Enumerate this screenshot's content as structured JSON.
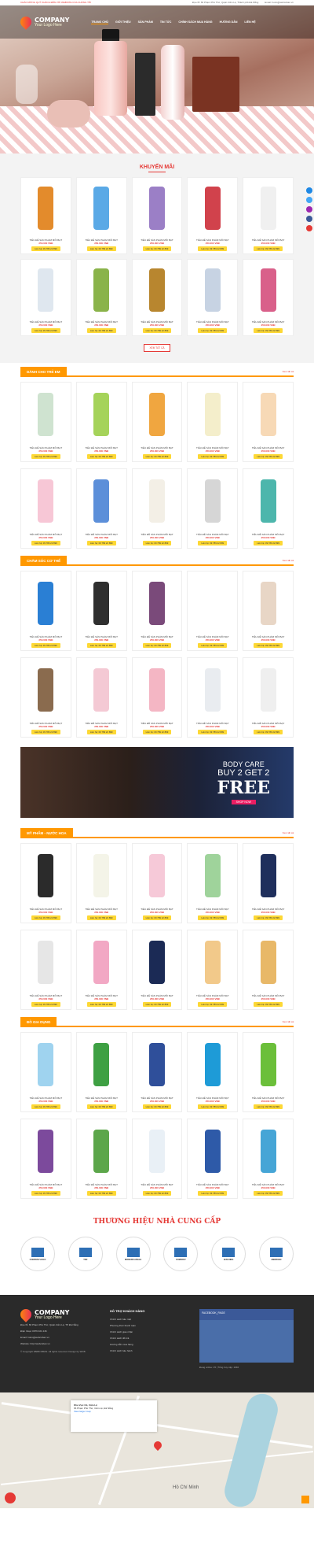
{
  "topbar": {
    "notice": "CHÀO MỪNG QUÝ KHÁCH ĐẾN VỚI WEBSITE CỦA CHÚNG TÔI",
    "address": "Địa chỉ: 66 Phạm Phú Thứ, Quận Cẩm Lệ, Thành phố Đà Nẵng",
    "email": "Email: hotro@webcoban.vn"
  },
  "logo": {
    "name": "COMPANY",
    "tagline": "Your Logo Here"
  },
  "nav": [
    "TRANG CHỦ",
    "GIỚI THIỆU",
    "SẢN PHẨM",
    "TIN TỨC",
    "CHÍNH SÁCH MUA HÀNG",
    "HƯỚNG DẪN",
    "LIÊN HỆ"
  ],
  "promo": {
    "title": "KHUYẾN MÃI",
    "view_more": "XEM TẤT CẢ",
    "products": [
      {
        "name": "TIÊU ĐỀ SẢN PHẨM MỖI BẠT",
        "price": "250.000 VNĐ",
        "cta": "Liên hệ: 09 789 22 899",
        "color": "#e38b2c"
      },
      {
        "name": "TIÊU ĐỀ SẢN PHẨM MỖI BẠT",
        "price": "250.000 VNĐ",
        "cta": "Liên hệ: 09 789 22 899",
        "color": "#5aa9e6"
      },
      {
        "name": "TIÊU ĐỀ SẢN PHẨM MỖI BẠT",
        "price": "250.000 VNĐ",
        "cta": "Liên hệ: 09 789 22 899",
        "color": "#9b7fc6"
      },
      {
        "name": "TIÊU ĐỀ SẢN PHẨM MỖI BẠT",
        "price": "250.000 VNĐ",
        "cta": "Liên hệ: 09 789 22 899",
        "color": "#d1424c"
      },
      {
        "name": "TIÊU ĐỀ SẢN PHẨM MỖI BẠT",
        "price": "250.000 VNĐ",
        "cta": "Liên hệ: 09 789 22 899",
        "color": "#f0f0f0"
      },
      {
        "name": "TIÊU ĐỀ SẢN PHẨM MỖI BẠT",
        "price": "250.000 VNĐ",
        "cta": "Liên hệ: 09 789 22 899",
        "color": "#dfe7ef"
      },
      {
        "name": "TIÊU ĐỀ SẢN PHẨM MỖI BẠT",
        "price": "250.000 VNĐ",
        "cta": "Liên hệ: 09 789 22 899",
        "color": "#8ab34a"
      },
      {
        "name": "TIÊU ĐỀ SẢN PHẨM MỖI BẠT",
        "price": "250.000 VNĐ",
        "cta": "Liên hệ: 09 789 22 899",
        "color": "#b8862f"
      },
      {
        "name": "TIÊU ĐỀ SẢN PHẨM MỖI BẠT",
        "price": "250.000 VNĐ",
        "cta": "Liên hệ: 09 789 22 899",
        "color": "#c7d3e3"
      },
      {
        "name": "TIÊU ĐỀ SẢN PHẨM MỖI BẠT",
        "price": "250.000 VNĐ",
        "cta": "Liên hệ: 09 789 22 899",
        "color": "#d9608a"
      }
    ]
  },
  "categories": [
    {
      "title": "DÀNH CHO TRẺ EM",
      "more": "Xem tất cả",
      "colors": [
        "#cfe3d0",
        "#a5d35a",
        "#f0a640",
        "#f4eecb",
        "#f7d9b6",
        "#f7c7d6",
        "#5c8fd9",
        "#f3efe6",
        "#d6d6d6",
        "#4db6ac"
      ]
    },
    {
      "title": "CHĂM SÓC CƠ THỂ",
      "more": "Xem tất cả",
      "colors": [
        "#2a7fd4",
        "#2f2f2f",
        "#7a4a7a",
        "#ffffff",
        "#e8d6c6",
        "#8a6b4e",
        "#f4c9d4",
        "#f4b6c4",
        "#e9ecf0",
        "#efefef"
      ]
    },
    {
      "title": "MỸ PHẨM - NƯỚC HOA",
      "more": "Xem tất cả",
      "colors": [
        "#2b2b2b",
        "#f4f4e8",
        "#f6c9d8",
        "#9fd39b",
        "#1f2f5c",
        "#e6e6e6",
        "#f2a8c4",
        "#1b2a55",
        "#f2c98a",
        "#e8b868"
      ]
    },
    {
      "title": "ĐỒ GIA DỤNG",
      "more": "Xem tất cả",
      "colors": [
        "#9fd3ef",
        "#3ea043",
        "#2f4f9a",
        "#1e9bd7",
        "#6bbf3a",
        "#7c4a9c",
        "#5ca64a",
        "#e9f0f6",
        "#2e5aa8",
        "#46a5d6"
      ]
    }
  ],
  "product_name": "TIÊU ĐỀ SẢN PHẨM MỖI BẠT",
  "product_price": "250.000 VNĐ",
  "product_cta": "Liên hệ: 09 789 22 899",
  "banner": {
    "line1": "BODY CARE",
    "line2": "BUY 2 GET 2",
    "line3": "FREE",
    "button": "SHOP NOW"
  },
  "suppliers": {
    "title": "THƯƠNG HIỆU NHÀ CUNG CẤP",
    "items": [
      "COMPANYLOGO",
      "TSR",
      "MODERN ANGLE",
      "COMPANY",
      "BUILDING",
      "MERIDIAN"
    ]
  },
  "footer": {
    "company_name": "COMPANY",
    "tagline": "Your Logo Here",
    "address": "Địa chỉ: 66 Phạm Phú Thứ, Quận Cẩm Lệ, TP Đà Nẵng",
    "hotline": "Điện thoại: 0976 021 246",
    "email": "Email: hotro@webcoban.vn",
    "website": "Website: http://webcoban.vn",
    "policy_title": "HỖ TRỢ KHÁCH HÀNG",
    "policies": [
      "Chính sách bảo mật",
      "Phương thức thanh toán",
      "Chính sách giao nhận",
      "Chính sách đổi trả",
      "Hướng dẫn mua hàng",
      "Chính sách bảo hành"
    ],
    "fb_page": "FACEBOOK_PAGE",
    "online": "Đang online: 15",
    "total": "Tổng truy cập: 1040",
    "copyright": "© Copyright WEBCOBAN. All rights reserved. Design by WCB"
  },
  "map": {
    "place": "Khu Vực Cũ, Cẩm Lệ",
    "address": "66 Phạm Phú Thứ, Cẩm Lệ, Đà Nẵng",
    "link": "View larger map",
    "city": "Hồ Chí Minh"
  }
}
